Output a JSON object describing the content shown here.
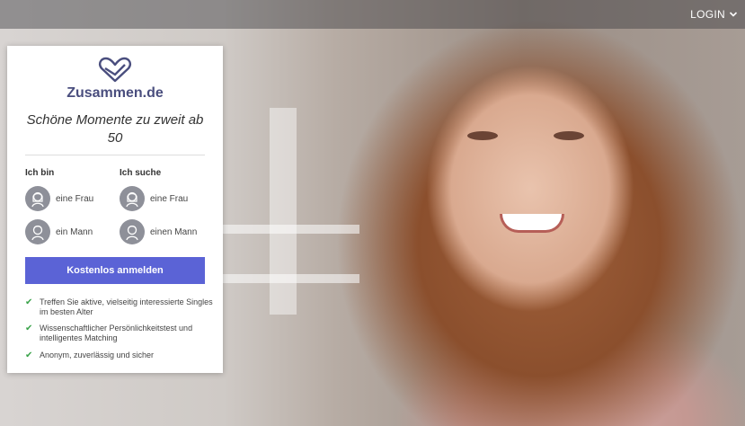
{
  "topbar": {
    "login_label": "LOGIN"
  },
  "card": {
    "brand": "Zusammen.de",
    "tagline": "Schöne Momente zu zweit ab 50",
    "i_am": {
      "heading": "Ich bin",
      "options": [
        {
          "label": "eine Frau",
          "icon": "woman-icon"
        },
        {
          "label": "ein Mann",
          "icon": "man-icon"
        }
      ]
    },
    "looking_for": {
      "heading": "Ich suche",
      "options": [
        {
          "label": "eine Frau",
          "icon": "woman-icon"
        },
        {
          "label": "einen Mann",
          "icon": "man-icon"
        }
      ]
    },
    "cta_label": "Kostenlos anmelden",
    "features": [
      "Treffen Sie aktive, vielseitig interessierte Singles im besten Alter",
      "Wissenschaftlicher Persönlichkeitstest und intelligentes Matching",
      "Anonym, zuverlässig und sicher"
    ]
  },
  "colors": {
    "accent": "#5b63d6",
    "brand": "#4a4e7e",
    "check": "#3aa34a",
    "avatar": "#8e9099"
  }
}
